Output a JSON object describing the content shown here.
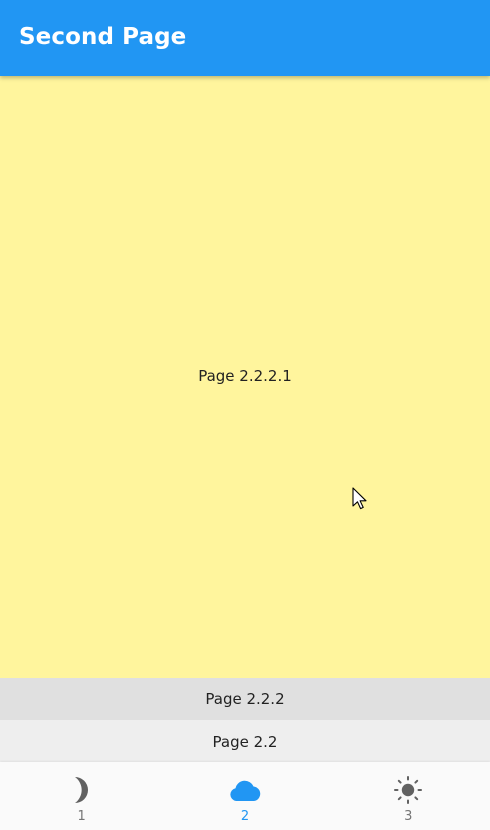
{
  "app_bar": {
    "title": "Second Page"
  },
  "content": {
    "label": "Page 2.2.2.1",
    "background": "#fff59d"
  },
  "stack_bars": [
    {
      "label": "Page 2.2.2"
    },
    {
      "label": "Page 2.2"
    }
  ],
  "bottom_nav": {
    "active_index": 1,
    "active_color": "#2196f3",
    "items": [
      {
        "label": "1",
        "icon": "moon-icon"
      },
      {
        "label": "2",
        "icon": "cloud-icon"
      },
      {
        "label": "3",
        "icon": "sun-icon"
      }
    ]
  }
}
